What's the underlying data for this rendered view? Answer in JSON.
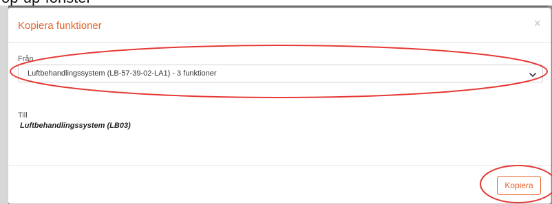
{
  "background": {
    "partial_text": "op-up-fönster"
  },
  "modal": {
    "title": "Kopiera funktioner",
    "close_glyph": "×",
    "from": {
      "label": "Från",
      "selected_value": "Luftbehandlingssystem (LB-57-39-02-LA1) - 3 funktioner"
    },
    "to": {
      "label": "Till",
      "value": "Luftbehandlingssystem (LB03)"
    },
    "footer": {
      "copy_label": "Kopiera"
    }
  },
  "colors": {
    "accent": "#e8622a",
    "annotation": "#e53935",
    "border": "#cfcfcf"
  },
  "icons": {
    "close": "close-icon",
    "select_arrow": "chevron-down-icon"
  }
}
